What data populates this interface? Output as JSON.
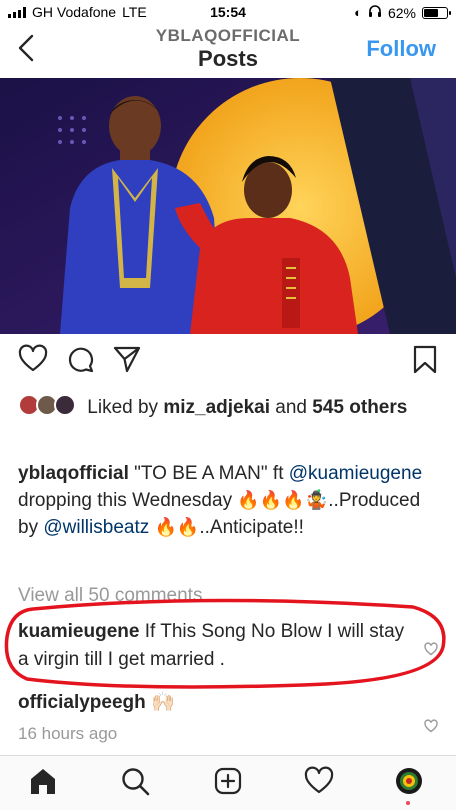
{
  "status": {
    "carrier": "GH Vodafone",
    "network": "LTE",
    "time": "15:54",
    "battery": "62%",
    "battery_fraction": 0.62
  },
  "header": {
    "username": "YBLAQOFFICIAL",
    "title": "Posts",
    "follow_label": "Follow"
  },
  "post": {
    "likes": {
      "prefix": "Liked by",
      "user": "miz_adjekai",
      "middle": "and",
      "count": "545",
      "suffix": "others"
    },
    "caption": {
      "user": "yblaqofficial",
      "part1": " \"TO BE A MAN\" ft ",
      "mention1": "@kuamieugene",
      "part2": " dropping this Wednesday ",
      "part3": "..Produced by ",
      "mention2": "@willisbeatz",
      "part4": "..Anticipate!!"
    },
    "view_all": "View all 50 comments",
    "comments": [
      {
        "user": "kuamieugene",
        "text": "If This Song No Blow I will stay a virgin till I get married ."
      },
      {
        "user": "officialypeegh",
        "text": ""
      }
    ],
    "time_ago": "16 hours ago"
  },
  "colors": {
    "accent": "#3897f0",
    "highlight_ring": "#e4141e",
    "like_red": "#ed4956"
  },
  "icons": {
    "actions": [
      "heart-icon",
      "comment-icon",
      "share-icon",
      "bookmark-icon"
    ],
    "tabs": [
      "home-icon",
      "search-icon",
      "new-post-icon",
      "activity-icon",
      "profile-avatar"
    ]
  }
}
